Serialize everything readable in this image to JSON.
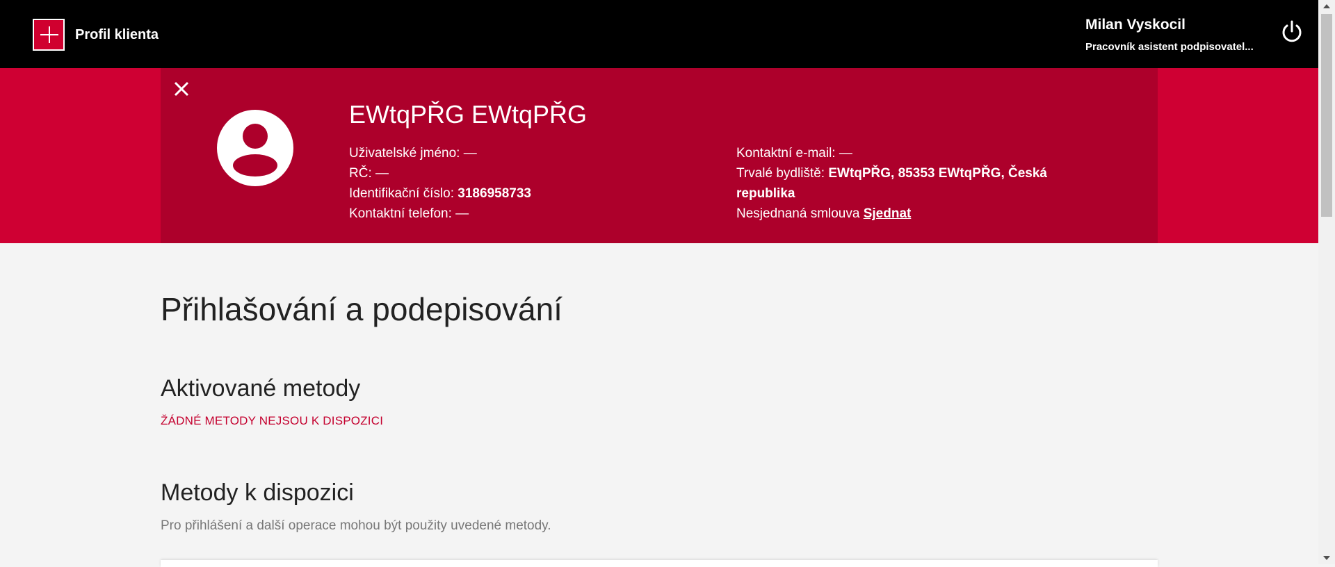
{
  "header": {
    "app_title": "Profil klienta",
    "user_name": "Milan Vyskocil",
    "user_role": "Pracovník asistent podpisovatel..."
  },
  "client": {
    "name": "EWtqPŘG EWtqPŘG",
    "username_label": "Uživatelské jméno: ",
    "username_value": "—",
    "rc_label": "RČ: ",
    "rc_value": "—",
    "id_label": "Identifikační číslo: ",
    "id_value": "3186958733",
    "phone_label": "Kontaktní telefon: ",
    "phone_value": "—",
    "email_label": "Kontaktní e-mail: ",
    "email_value": "—",
    "address_label": "Trvalé bydliště: ",
    "address_value": "EWtqPŘG, 85353 EWtqPŘG, Česká republika",
    "contract_label": "Nesjednaná smlouva ",
    "contract_link": "Sjednat"
  },
  "main": {
    "page_title": "Přihlašování a podepisování",
    "activated_title": "Aktivované metody",
    "activated_empty": "ŽÁDNÉ METODY NEJSOU K DISPOZICI",
    "available_title": "Metody k dispozici",
    "available_desc": "Pro přihlášení a další operace mohou být použity uvedené metody."
  },
  "colors": {
    "topbar": "#000000",
    "banner": "#cf0033",
    "banner_inner": "#ad002b",
    "accent": "#c4002e",
    "page_bg": "#f4f4f4"
  },
  "icons": [
    "logo-icon",
    "power-icon",
    "close-icon",
    "avatar-icon"
  ]
}
